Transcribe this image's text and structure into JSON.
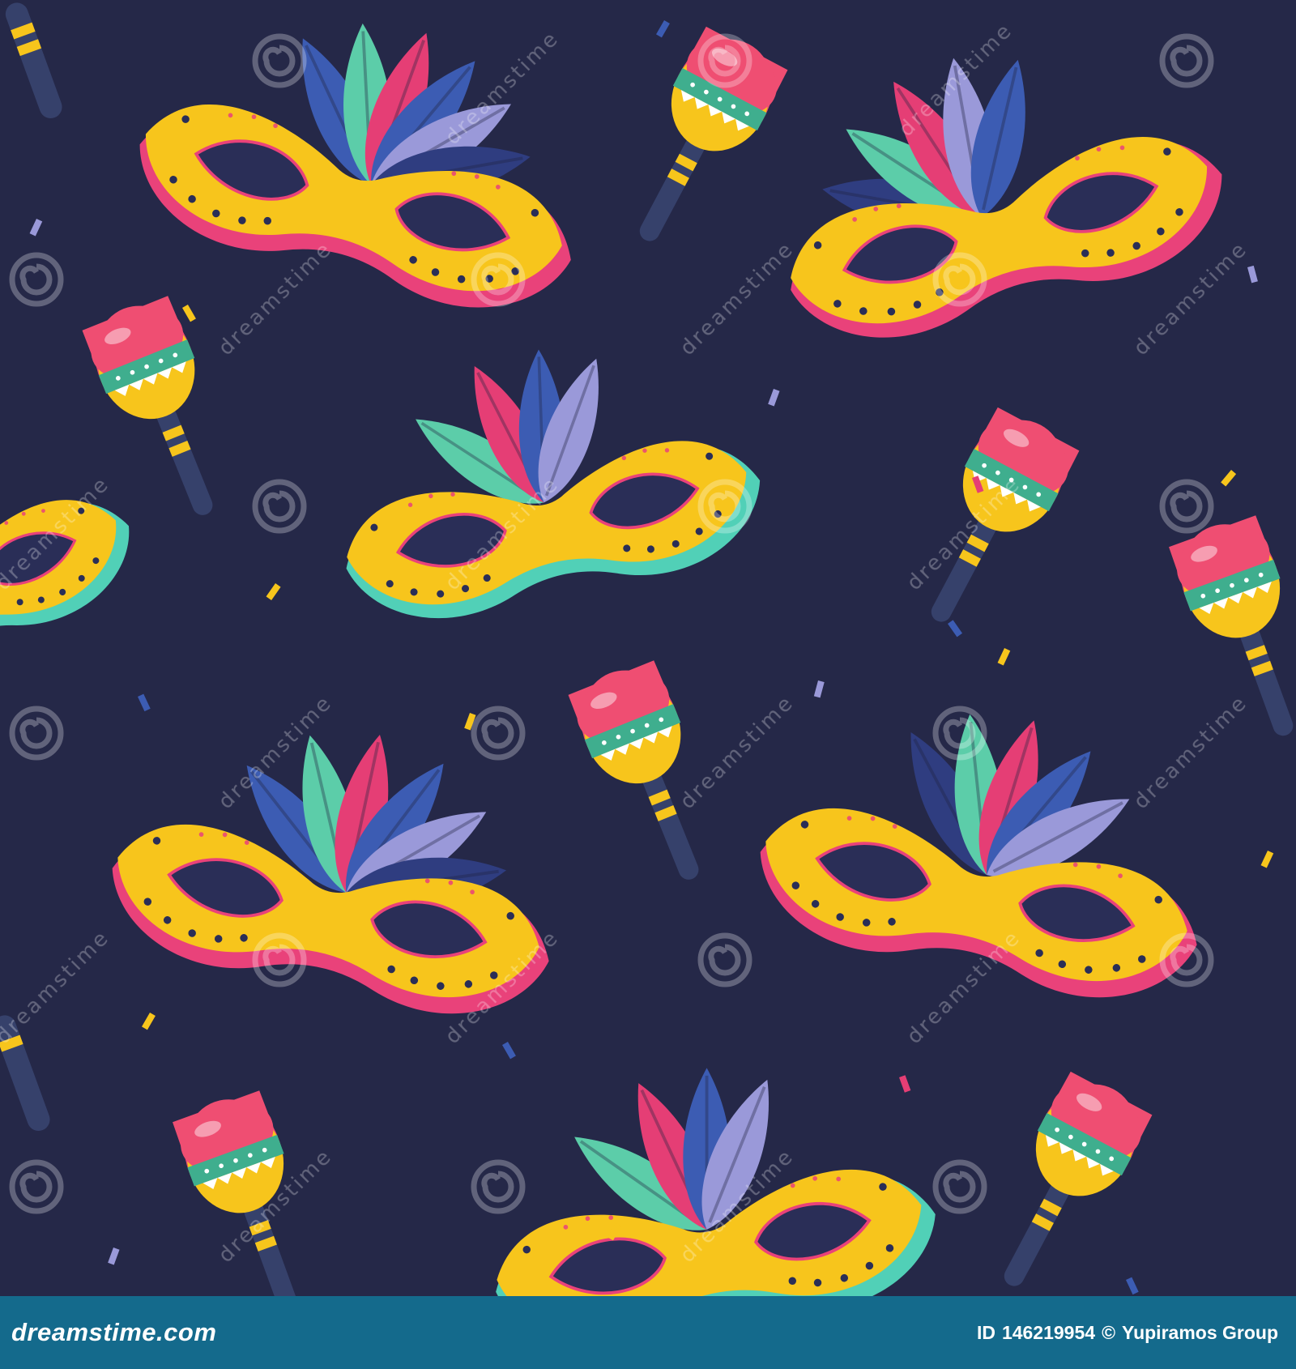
{
  "image": {
    "subject": "carnival masks with feathers and maracas seamless pattern",
    "background_color": "#252848",
    "palette": {
      "mask_yellow": "#f7c51c",
      "mask_rim_pink": "#e9427a",
      "mask_rim_teal": "#51d0b7",
      "feather_blue": "#3c5cb3",
      "feather_lilac": "#9a99d9",
      "feather_mint": "#5ccda9",
      "feather_pink": "#e53e75",
      "maraca_head": "#ef4e72",
      "maraca_band": "#3fae8e",
      "maraca_handle": "#36416b"
    },
    "icons": [
      "mask-icon",
      "feather-icon",
      "maraca-icon",
      "confetti-icon",
      "watermark-spiral-icon"
    ]
  },
  "watermark": {
    "text": "dreamstime"
  },
  "footer": {
    "brand": "dreamstime.com",
    "id_label": "ID",
    "id_value": "146219954",
    "copyright": "©",
    "author": "Yupiramos Group",
    "background": "#146a8c"
  }
}
